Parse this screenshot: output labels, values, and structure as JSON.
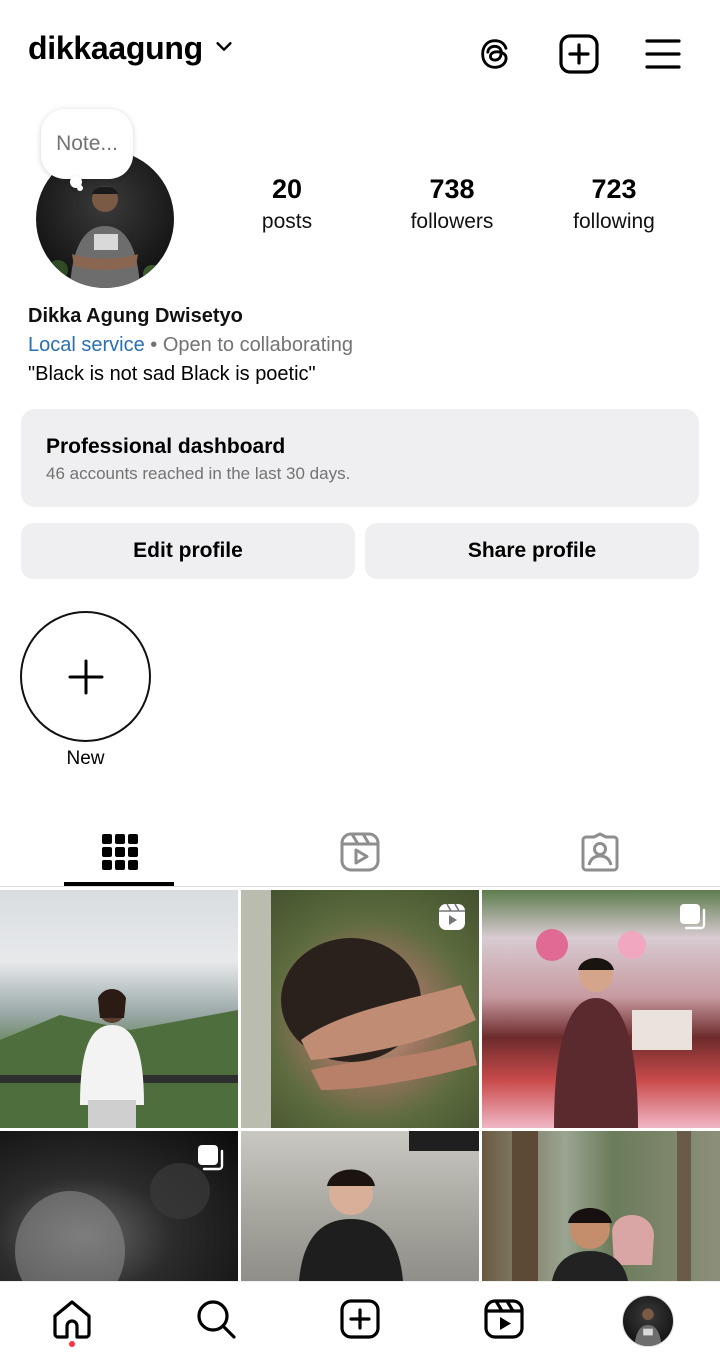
{
  "header": {
    "username": "dikkaagung"
  },
  "profile": {
    "note_placeholder": "Note...",
    "stats": {
      "posts": {
        "value": "20",
        "label": "posts"
      },
      "followers": {
        "value": "738",
        "label": "followers"
      },
      "following": {
        "value": "723",
        "label": "following"
      }
    },
    "name": "Dikka Agung Dwisetyo",
    "category": "Local service",
    "separator": " • ",
    "availability": "Open to collaborating",
    "bio": "\"Black is not sad Black is poetic\""
  },
  "dashboard": {
    "title": "Professional dashboard",
    "subtitle": "46 accounts reached in the last 30 days."
  },
  "buttons": {
    "edit": "Edit profile",
    "share": "Share profile"
  },
  "highlights": {
    "new_label": "New"
  },
  "tabs": {
    "active": "grid",
    "items": [
      "grid-icon",
      "reels-icon",
      "tagged-icon"
    ]
  },
  "grid": {
    "posts": [
      {
        "badge": "none"
      },
      {
        "badge": "reel-icon"
      },
      {
        "badge": "carousel-icon"
      },
      {
        "badge": "carousel-icon"
      },
      {
        "badge": "none"
      },
      {
        "badge": "none"
      }
    ]
  },
  "bottom_nav": {
    "items": [
      "home-icon",
      "search-icon",
      "create-icon",
      "reels-icon",
      "profile-avatar"
    ],
    "active": "home",
    "notification_color": "#ff3040"
  },
  "colors": {
    "link_blue": "#2b6fb3",
    "muted_gray": "#737373",
    "button_bg": "#efeff1"
  }
}
